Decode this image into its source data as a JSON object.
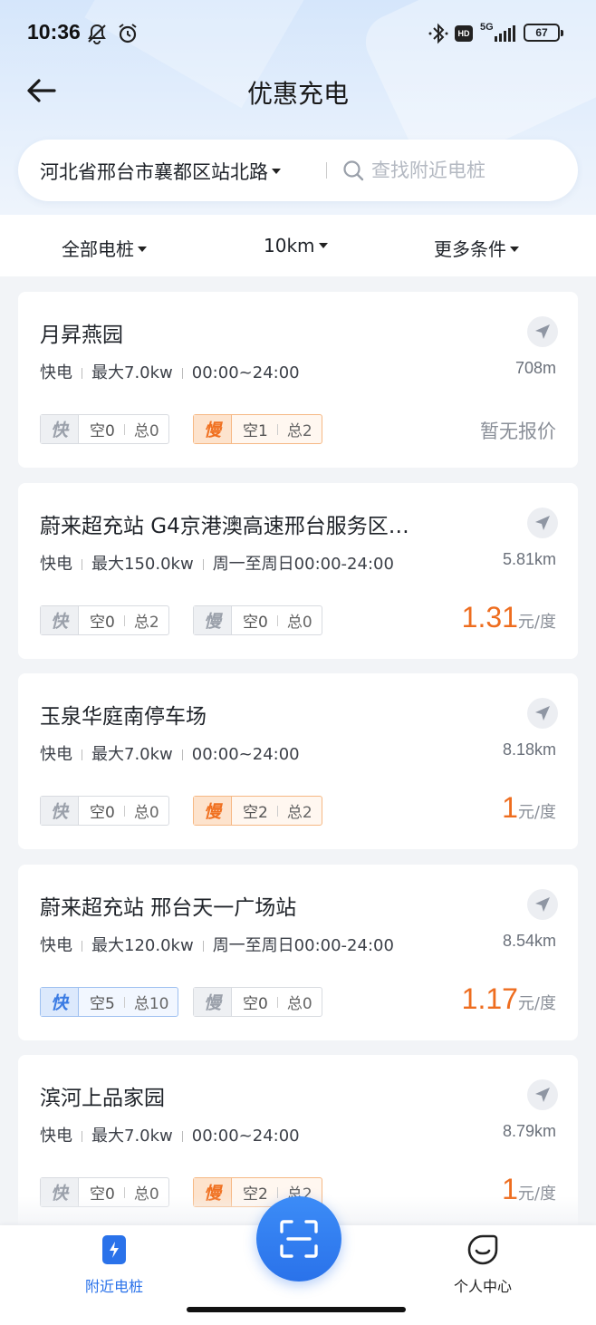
{
  "status": {
    "time": "10:36",
    "battery": "67",
    "network": "5G",
    "hd": "HD"
  },
  "header": {
    "title": "优惠充电"
  },
  "search": {
    "location": "河北省邢台市襄都区站北路",
    "placeholder": "查找附近电桩"
  },
  "filters": [
    {
      "label": "全部电桩"
    },
    {
      "label": "10km"
    },
    {
      "label": "更多条件"
    }
  ],
  "stations": [
    {
      "name": "月昇燕园",
      "type": "快电",
      "power": "最大7.0kw",
      "hours": "00:00~24:00",
      "distance": "708m",
      "fast": {
        "tag": "快",
        "free": "空0",
        "total": "总0"
      },
      "slow": {
        "tag": "慢",
        "free": "空1",
        "total": "总2"
      },
      "price": "",
      "price_unit": "",
      "no_price": "暂无报价"
    },
    {
      "name": "蔚来超充站 G4京港澳高速邢台服务区…",
      "type": "快电",
      "power": "最大150.0kw",
      "hours": "周一至周日00:00-24:00",
      "distance": "5.81km",
      "fast": {
        "tag": "快",
        "free": "空0",
        "total": "总2"
      },
      "slow": {
        "tag": "慢",
        "free": "空0",
        "total": "总0"
      },
      "price": "1.31",
      "price_unit": "元/度",
      "no_price": ""
    },
    {
      "name": "玉泉华庭南停车场",
      "type": "快电",
      "power": "最大7.0kw",
      "hours": "00:00~24:00",
      "distance": "8.18km",
      "fast": {
        "tag": "快",
        "free": "空0",
        "total": "总0"
      },
      "slow": {
        "tag": "慢",
        "free": "空2",
        "total": "总2"
      },
      "price": "1",
      "price_unit": "元/度",
      "no_price": ""
    },
    {
      "name": "蔚来超充站 邢台天一广场站",
      "type": "快电",
      "power": "最大120.0kw",
      "hours": "周一至周日00:00-24:00",
      "distance": "8.54km",
      "fast": {
        "tag": "快",
        "free": "空5",
        "total": "总10"
      },
      "slow": {
        "tag": "慢",
        "free": "空0",
        "total": "总0"
      },
      "price": "1.17",
      "price_unit": "元/度",
      "no_price": ""
    },
    {
      "name": "滨河上品家园",
      "type": "快电",
      "power": "最大7.0kw",
      "hours": "00:00~24:00",
      "distance": "8.79km",
      "fast": {
        "tag": "快",
        "free": "空0",
        "total": "总0"
      },
      "slow": {
        "tag": "慢",
        "free": "空2",
        "total": "总2"
      },
      "price": "1",
      "price_unit": "元/度",
      "no_price": ""
    }
  ],
  "bottom_nav": {
    "nearby": "附近电桩",
    "profile": "个人中心"
  },
  "colors": {
    "accent": "#2a72ea",
    "price": "#ee6d1f"
  }
}
